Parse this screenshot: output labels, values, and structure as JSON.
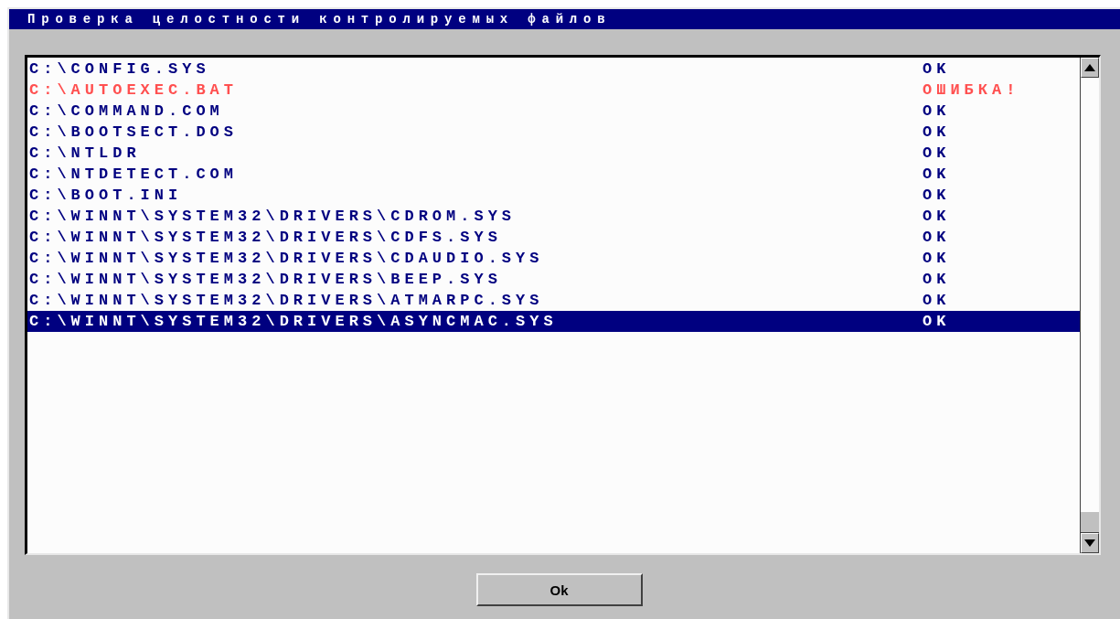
{
  "window": {
    "title": "Проверка целостности контролируемых файлов"
  },
  "files": [
    {
      "path": "C:\\CONFIG.SYS",
      "status": "OK",
      "error": false,
      "selected": false
    },
    {
      "path": "C:\\AUTOEXEC.BAT",
      "status": "ОШИБКА!",
      "error": true,
      "selected": false
    },
    {
      "path": "C:\\COMMAND.COM",
      "status": "OK",
      "error": false,
      "selected": false
    },
    {
      "path": "C:\\BOOTSECT.DOS",
      "status": "OK",
      "error": false,
      "selected": false
    },
    {
      "path": "C:\\NTLDR",
      "status": "OK",
      "error": false,
      "selected": false
    },
    {
      "path": "C:\\NTDETECT.COM",
      "status": "OK",
      "error": false,
      "selected": false
    },
    {
      "path": "C:\\BOOT.INI",
      "status": "OK",
      "error": false,
      "selected": false
    },
    {
      "path": "C:\\WINNT\\SYSTEM32\\DRIVERS\\CDROM.SYS",
      "status": "OK",
      "error": false,
      "selected": false
    },
    {
      "path": "C:\\WINNT\\SYSTEM32\\DRIVERS\\CDFS.SYS",
      "status": "OK",
      "error": false,
      "selected": false
    },
    {
      "path": "C:\\WINNT\\SYSTEM32\\DRIVERS\\CDAUDIO.SYS",
      "status": "OK",
      "error": false,
      "selected": false
    },
    {
      "path": "C:\\WINNT\\SYSTEM32\\DRIVERS\\BEEP.SYS",
      "status": "OK",
      "error": false,
      "selected": false
    },
    {
      "path": "C:\\WINNT\\SYSTEM32\\DRIVERS\\ATMARPC.SYS",
      "status": "OK",
      "error": false,
      "selected": false
    },
    {
      "path": "C:\\WINNT\\SYSTEM32\\DRIVERS\\ASYNCMAC.SYS",
      "status": "OK",
      "error": false,
      "selected": true
    }
  ],
  "buttons": [
    "Ok"
  ]
}
